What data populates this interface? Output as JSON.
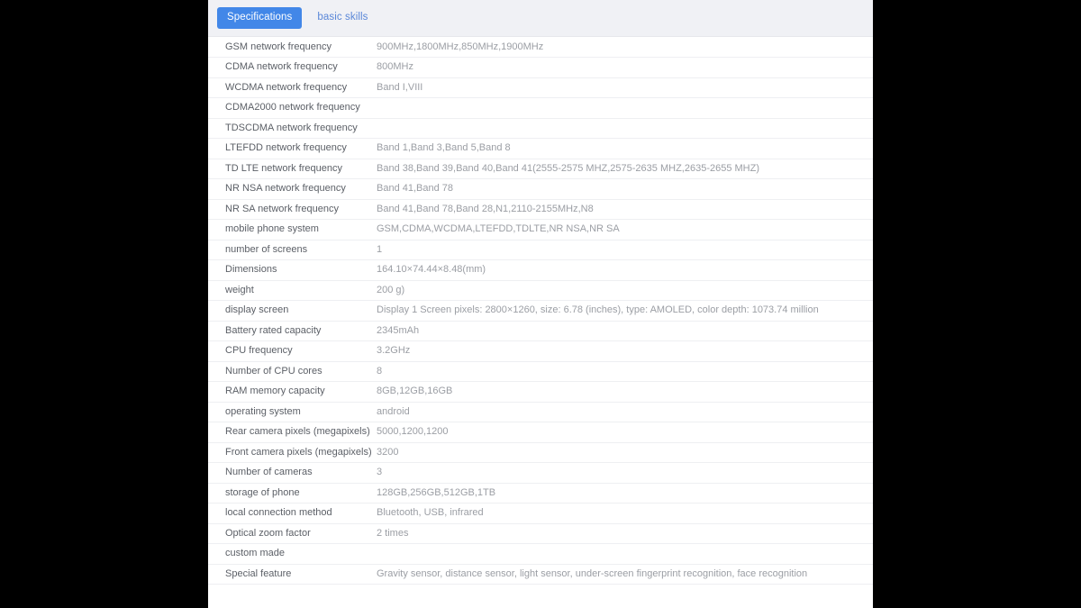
{
  "tabs": [
    {
      "label": "Specifications",
      "active": true
    },
    {
      "label": "basic skills",
      "active": false
    }
  ],
  "colors": {
    "active_tab_background": "#4287e8",
    "active_tab_text": "#ffffff",
    "inactive_tab_text": "#5a87d8",
    "tab_bar_background": "#f0f1f5",
    "panel_background": "#ffffff",
    "page_background": "#000000",
    "label_text": "#5b5f66",
    "value_text": "#9b9ea4",
    "row_divider": "#eeeff2"
  },
  "spec_table": {
    "rows": [
      {
        "label": "GSM network frequency",
        "value": "900MHz,1800MHz,850MHz,1900MHz"
      },
      {
        "label": "CDMA network frequency",
        "value": "800MHz"
      },
      {
        "label": "WCDMA network frequency",
        "value": "Band I,VIII"
      },
      {
        "label": "CDMA2000 network frequency",
        "value": ""
      },
      {
        "label": "TDSCDMA network frequency",
        "value": ""
      },
      {
        "label": "LTEFDD network frequency",
        "value": "Band 1,Band 3,Band 5,Band 8"
      },
      {
        "label": "TD LTE network frequency",
        "value": "Band 38,Band 39,Band 40,Band 41(2555-2575 MHZ,2575-2635 MHZ,2635-2655 MHZ)"
      },
      {
        "label": "NR NSA network frequency",
        "value": "Band 41,Band 78"
      },
      {
        "label": "NR SA network frequency",
        "value": "Band 41,Band 78,Band 28,N1,2110-2155MHz,N8"
      },
      {
        "label": "mobile phone system",
        "value": "GSM,CDMA,WCDMA,LTEFDD,TDLTE,NR NSA,NR SA"
      },
      {
        "label": "number of screens",
        "value": "1"
      },
      {
        "label": "Dimensions",
        "value": "164.10×74.44×8.48(mm)"
      },
      {
        "label": "weight",
        "value": "200 g)"
      },
      {
        "label": "display screen",
        "value": "Display 1 Screen pixels: 2800×1260, size: 6.78 (inches), type: AMOLED, color depth: 1073.74 million"
      },
      {
        "label": "Battery rated capacity",
        "value": "2345mAh"
      },
      {
        "label": "CPU frequency",
        "value": "3.2GHz"
      },
      {
        "label": "Number of CPU cores",
        "value": "8"
      },
      {
        "label": "RAM memory capacity",
        "value": "8GB,12GB,16GB"
      },
      {
        "label": "operating system",
        "value": "android"
      },
      {
        "label": "Rear camera pixels (megapixels)",
        "value": "5000,1200,1200"
      },
      {
        "label": "Front camera pixels (megapixels)",
        "value": "3200"
      },
      {
        "label": "Number of cameras",
        "value": "3"
      },
      {
        "label": "storage of phone",
        "value": "128GB,256GB,512GB,1TB"
      },
      {
        "label": "local connection method",
        "value": "Bluetooth, USB, infrared"
      },
      {
        "label": "Optical zoom factor",
        "value": "2 times"
      },
      {
        "label": "custom made",
        "value": ""
      },
      {
        "label": "Special feature",
        "value": "Gravity sensor, distance sensor, light sensor, under-screen fingerprint recognition, face recognition"
      }
    ]
  }
}
